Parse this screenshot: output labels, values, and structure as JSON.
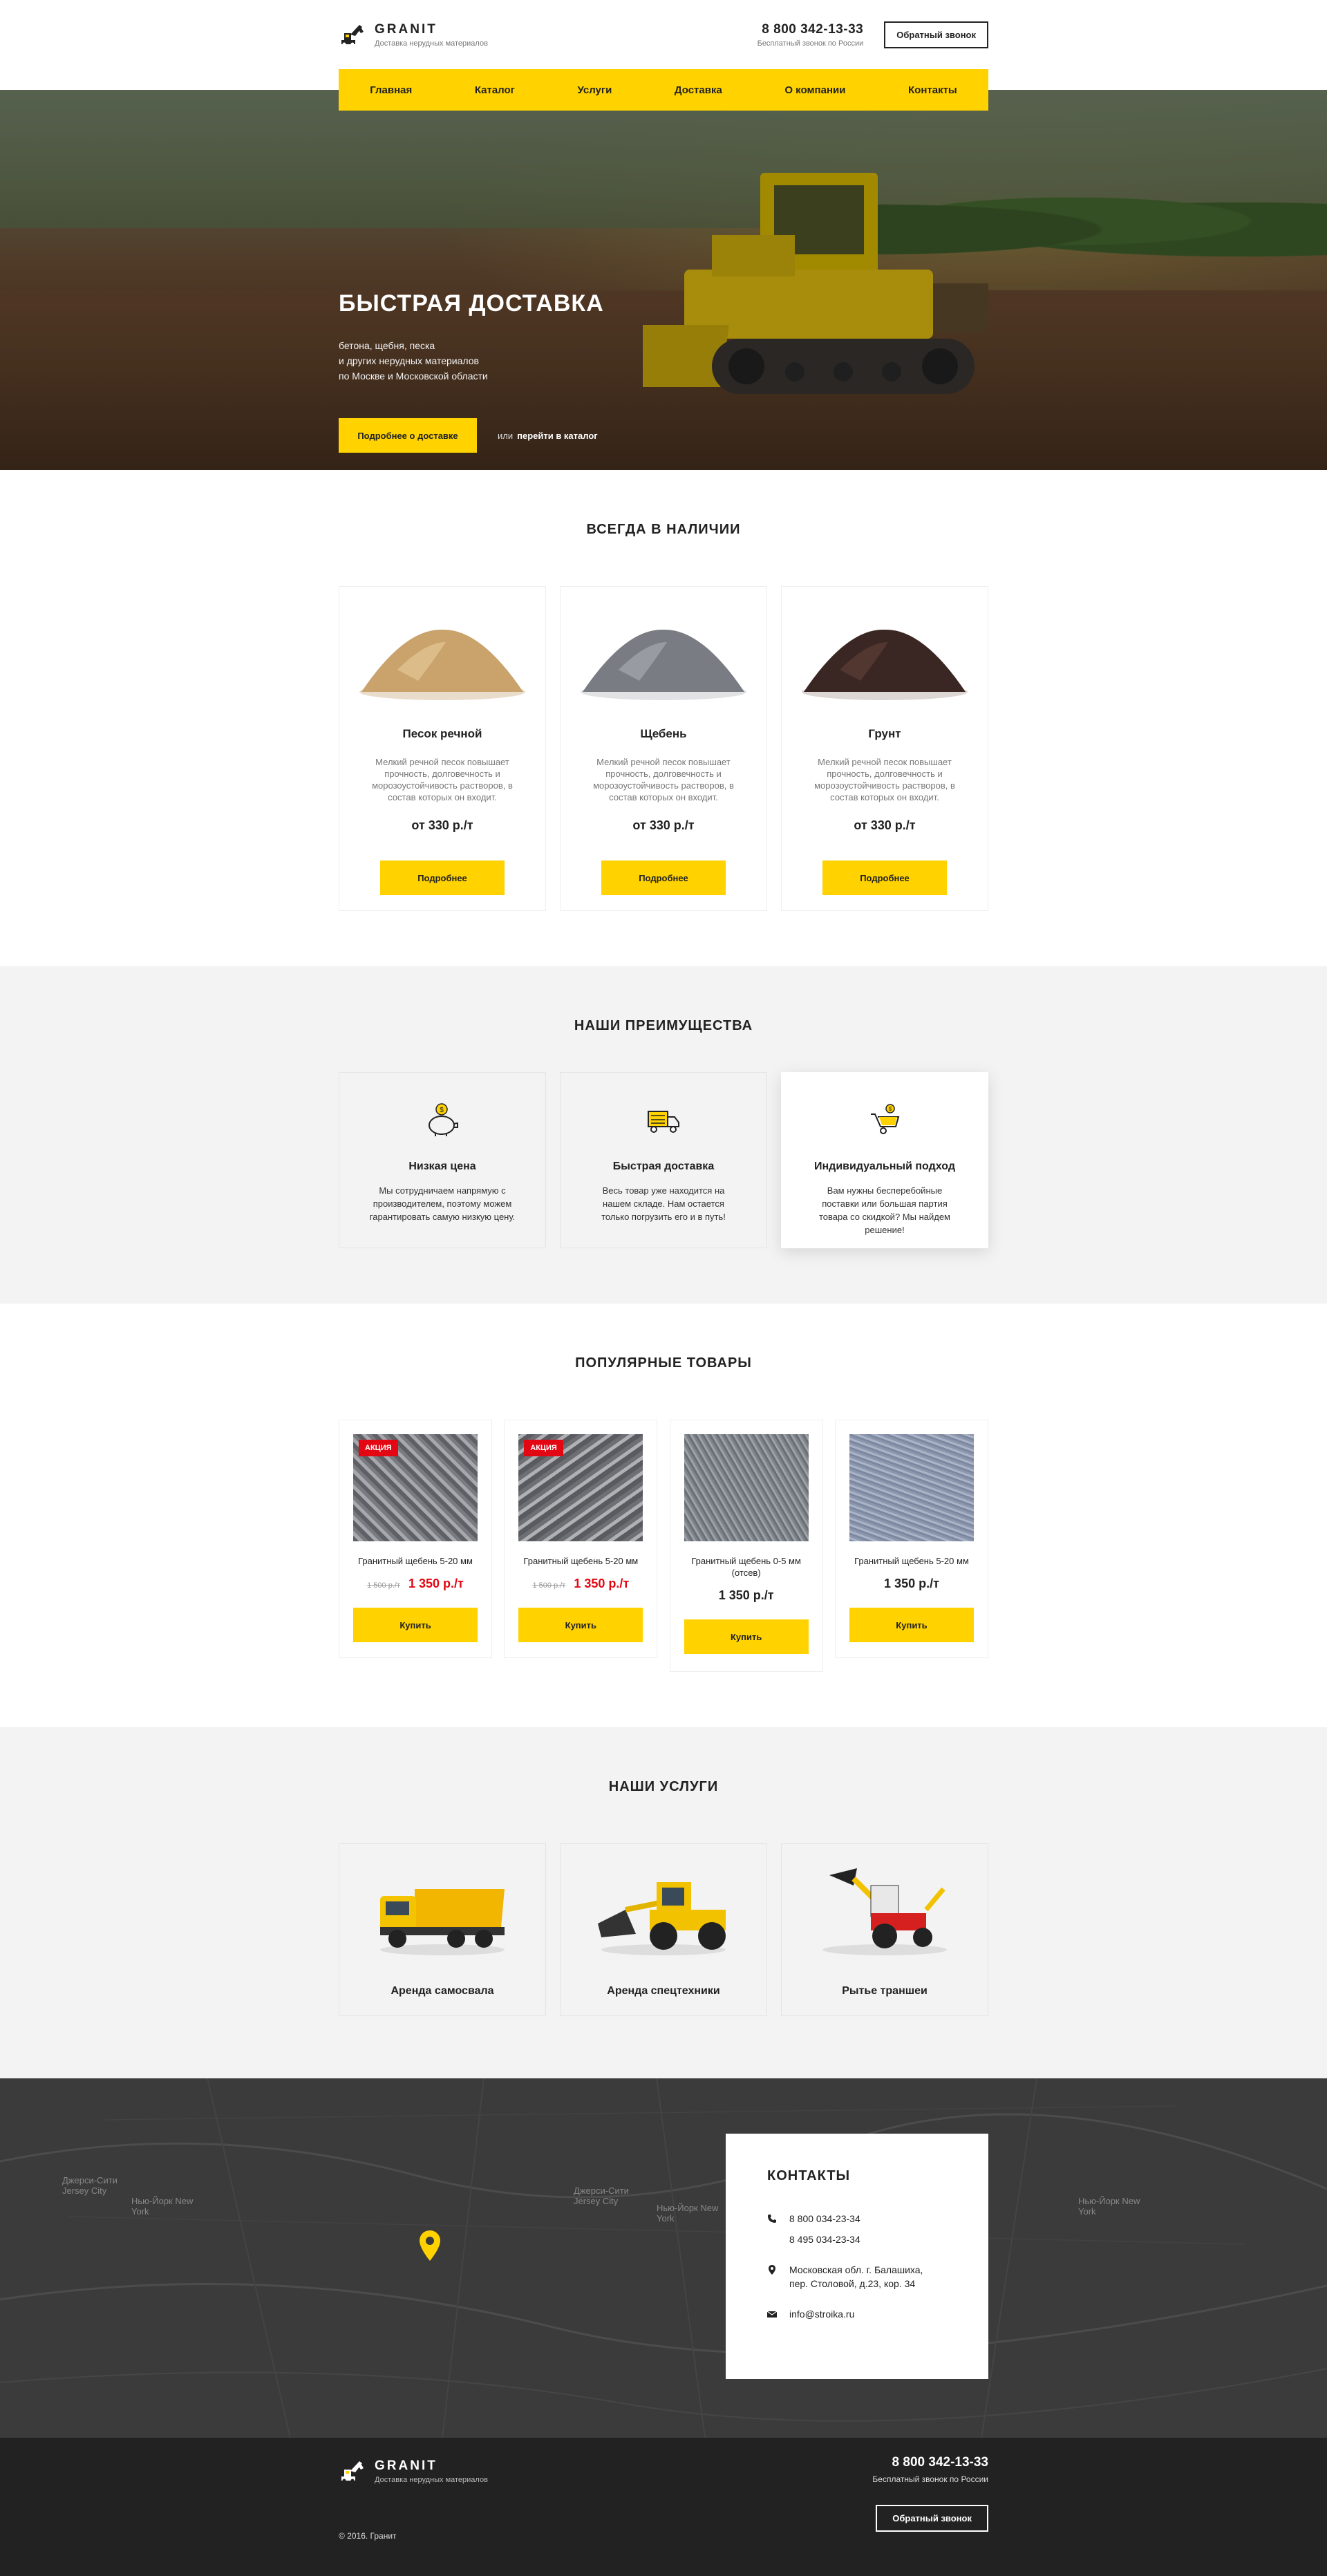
{
  "header": {
    "logo_name": "GRANIT",
    "logo_tagline": "Доставка нерудных материалов",
    "phone": "8 800 342-13-33",
    "phone_note": "Бесплатный звонок по России",
    "callback_label": "Обратный звонок"
  },
  "nav": [
    "Главная",
    "Каталог",
    "Услуги",
    "Доставка",
    "О компании",
    "Контакты"
  ],
  "hero": {
    "title": "БЫСТРАЯ ДОСТАВКА",
    "subtitle_lines": [
      "бетона, щебня, песка",
      "и других нерудных материалов",
      "по Москве и Московской области"
    ],
    "cta_label": "Подробнее о доставке",
    "or_text": "или",
    "catalog_link": "перейти в каталог"
  },
  "stock": {
    "title": "ВСЕГДА В НАЛИЧИИ",
    "items": [
      {
        "name": "Песок речной",
        "desc": "Мелкий речной песок повышает прочность, долговечность и морозоустойчивость растворов, в состав которых он входит.",
        "price": "от 330 р./т",
        "button": "Подробнее",
        "color": "#c9a36b"
      },
      {
        "name": "Щебень",
        "desc": "Мелкий речной песок повышает прочность, долговечность и морозоустойчивость растворов, в состав которых он входит.",
        "price": "от 330 р./т",
        "button": "Подробнее",
        "color": "#7a7c84"
      },
      {
        "name": "Грунт",
        "desc": "Мелкий речной песок повышает прочность, долговечность и морозоустойчивость растворов, в состав которых он входит.",
        "price": "от 330 р./т",
        "button": "Подробнее",
        "color": "#3a2622"
      }
    ]
  },
  "advantages": {
    "title": "НАШИ ПРЕИМУЩЕСТВА",
    "items": [
      {
        "title": "Низкая цена",
        "text": "Мы сотрудничаем напрямую с производителем, поэтому можем гарантировать самую низкую цену.",
        "icon": "piggy-bank-icon"
      },
      {
        "title": "Быстрая доставка",
        "text": "Весь товар уже находится на нашем складе. Нам остается только погрузить его и в путь!",
        "icon": "truck-icon"
      },
      {
        "title": "Индивидуальный подход",
        "text": "Вам нужны бесперебойные поставки или большая партия товара со скидкой? Мы найдем решение!",
        "icon": "wheelbarrow-icon"
      }
    ]
  },
  "popular": {
    "title": "ПОПУЛЯРНЫЕ ТОВАРЫ",
    "items": [
      {
        "name": "Гранитный щебень 5-20 мм",
        "old_price": "1 500 р./т",
        "price": "1 350 р./т",
        "badge": "АКЦИЯ",
        "button": "Купить"
      },
      {
        "name": "Гранитный щебень 5-20 мм",
        "old_price": "1 500 р./т",
        "price": "1 350 р./т",
        "badge": "АКЦИЯ",
        "button": "Купить"
      },
      {
        "name": "Гранитный щебень 0-5 мм (отсев)",
        "old_price": "",
        "price": "1 350 р./т",
        "badge": "",
        "button": "Купить"
      },
      {
        "name": "Гранитный щебень 5-20 мм",
        "old_price": "",
        "price": "1 350 р./т",
        "badge": "",
        "button": "Купить"
      }
    ]
  },
  "services": {
    "title": "НАШИ УСЛУГИ",
    "items": [
      {
        "name": "Аренда самосвала",
        "icon": "dump-truck-icon"
      },
      {
        "name": "Аренда спецтехники",
        "icon": "wheel-loader-icon"
      },
      {
        "name": "Рытье траншеи",
        "icon": "backhoe-icon"
      }
    ]
  },
  "map": {
    "labels": [
      "Нью-Йорк New York",
      "Джерси-Сити Jersey City",
      "Нью-Йорк New York",
      "Джерси-Сити Jersey City",
      "Нью-Йорк New York"
    ]
  },
  "contacts": {
    "title": "КОНТАКТЫ",
    "phone1": "8 800 034-23-34",
    "phone2": "8 495 034-23-34",
    "address1": "Московская обл. г. Балашиха,",
    "address2": "пер. Столовой, д.23, кор. 34",
    "email": "info@stroika.ru"
  },
  "footer": {
    "logo_name": "GRANIT",
    "logo_tagline": "Доставка нерудных материалов",
    "phone": "8 800 342-13-33",
    "phone_note": "Бесплатный звонок по России",
    "callback_label": "Обратный звонок",
    "copyright": "© 2016. Гранит"
  },
  "colors": {
    "accent": "#ffd200",
    "sale": "#e30613",
    "dark": "#222222"
  }
}
